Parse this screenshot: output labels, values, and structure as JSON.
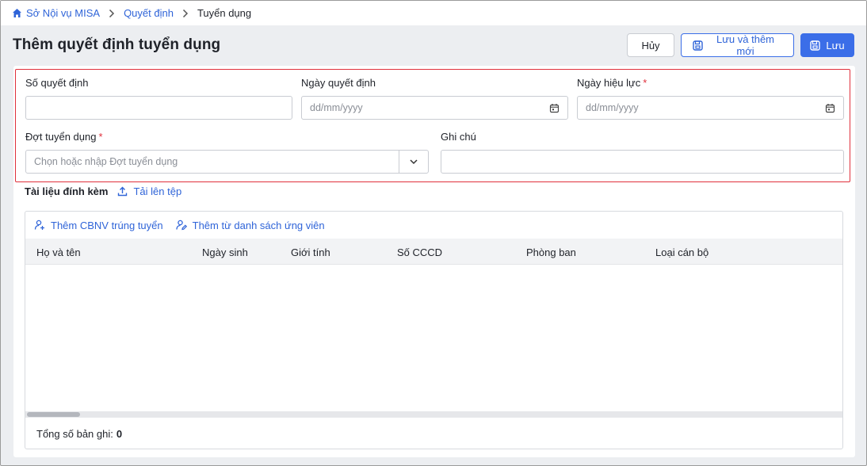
{
  "breadcrumb": {
    "items": [
      "Sở Nội vụ MISA",
      "Quyết định",
      "Tuyển dụng"
    ]
  },
  "header": {
    "title": "Thêm quyết định tuyển dụng",
    "cancel_label": "Hủy",
    "save_new_label": "Lưu và thêm mới",
    "save_label": "Lưu"
  },
  "form": {
    "decision_number": {
      "label": "Số quyết định",
      "value": ""
    },
    "decision_date": {
      "label": "Ngày quyết định",
      "placeholder": "dd/mm/yyyy"
    },
    "effective_date": {
      "label": "Ngày hiệu lực",
      "required": "*",
      "placeholder": "dd/mm/yyyy"
    },
    "recruitment_round": {
      "label": "Đợt tuyển dụng",
      "required": "*",
      "placeholder": "Chọn hoặc nhập Đợt tuyển dụng"
    },
    "note": {
      "label": "Ghi chú",
      "value": ""
    }
  },
  "attachments": {
    "title": "Tài liệu đính kèm",
    "upload_label": "Tải lên tệp"
  },
  "grid": {
    "actions": [
      "Thêm CBNV trúng tuyển",
      "Thêm từ danh sách ứng viên"
    ],
    "columns": [
      "Họ và tên",
      "Ngày sinh",
      "Giới tính",
      "Số CCCD",
      "Phòng ban",
      "Loại cán bộ"
    ],
    "rows": [],
    "footer_label": "Tổng số bản ghi:",
    "total": "0"
  },
  "colors": {
    "accent": "#3b6ee8",
    "link": "#2f64d8",
    "required": "#e0303c",
    "highlight_border": "#e0303c"
  },
  "icons": [
    "home-icon",
    "chevron-right-icon",
    "save-icon",
    "calendar-icon",
    "chevron-down-icon",
    "upload-icon",
    "add-user-icon",
    "user-edit-icon"
  ]
}
